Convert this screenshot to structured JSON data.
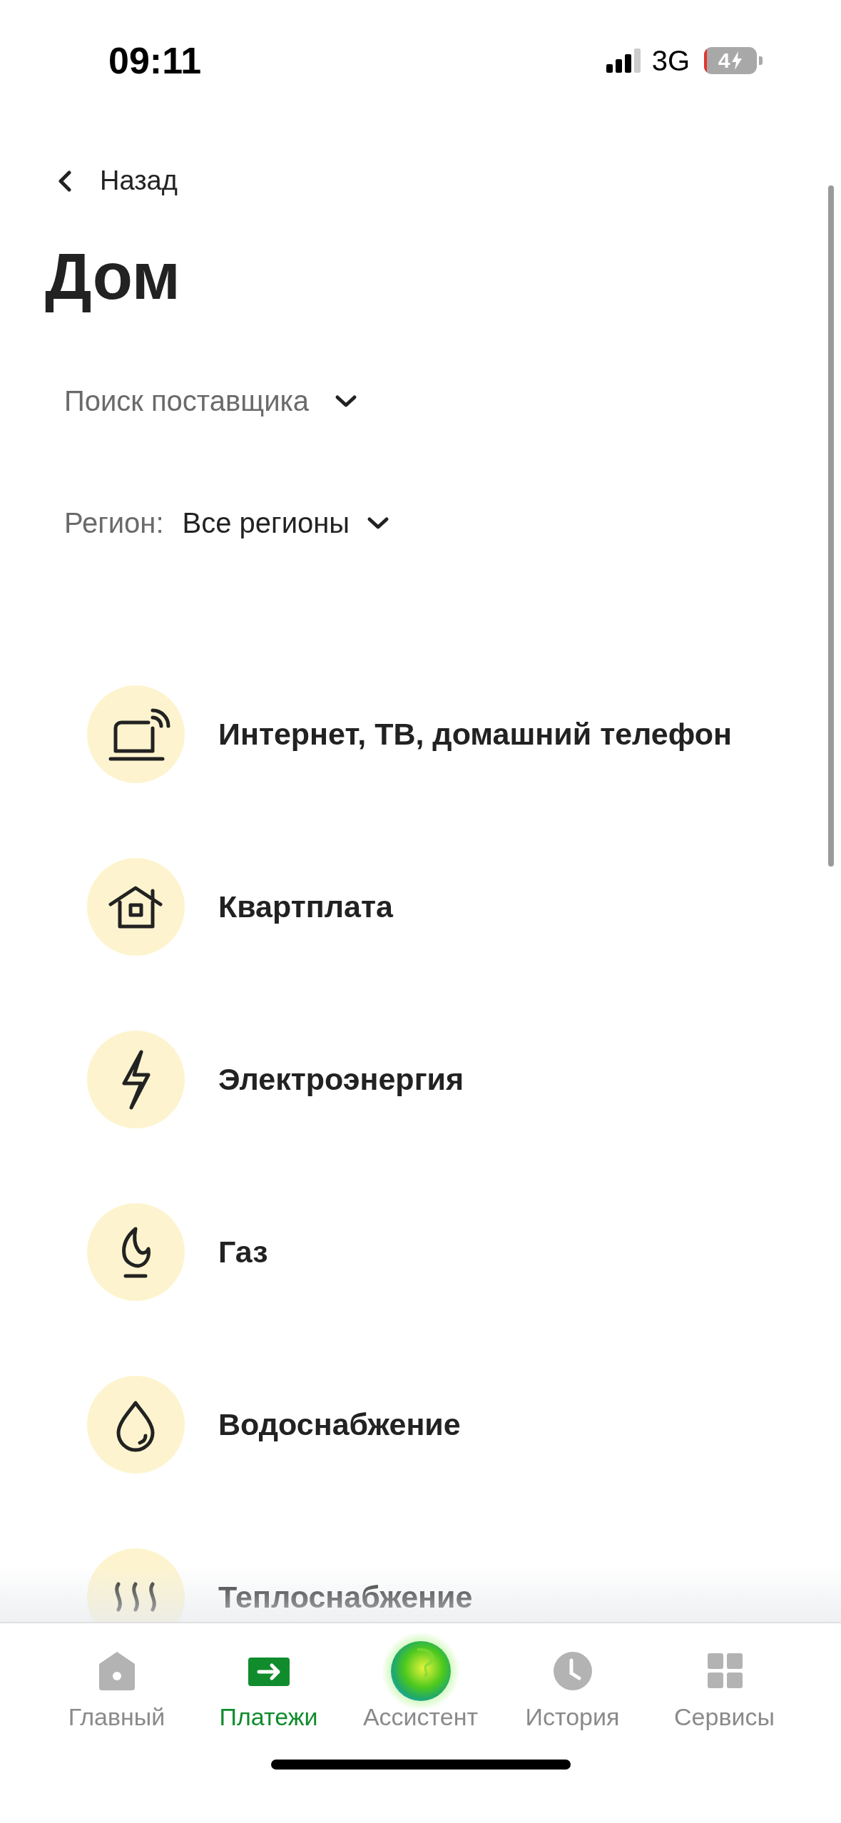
{
  "status_bar": {
    "time": "09:11",
    "network": "3G",
    "battery": "4",
    "charging": true
  },
  "back": {
    "label": "Назад"
  },
  "title": "Дом",
  "search": {
    "placeholder": "Поиск поставщика"
  },
  "region": {
    "label": "Регион:",
    "value": "Все регионы"
  },
  "categories": [
    {
      "label": "Интернет, ТВ, домашний телефон"
    },
    {
      "label": "Квартплата"
    },
    {
      "label": "Электроэнергия"
    },
    {
      "label": "Газ"
    },
    {
      "label": "Водоснабжение"
    },
    {
      "label": "Теплоснабжение"
    }
  ],
  "tab_bar": [
    {
      "label": "Главный",
      "selected": false
    },
    {
      "label": "Платежи",
      "selected": true
    },
    {
      "label": "Ассистент",
      "selected": false
    },
    {
      "label": "История",
      "selected": false
    },
    {
      "label": "Сервисы",
      "selected": false
    }
  ]
}
